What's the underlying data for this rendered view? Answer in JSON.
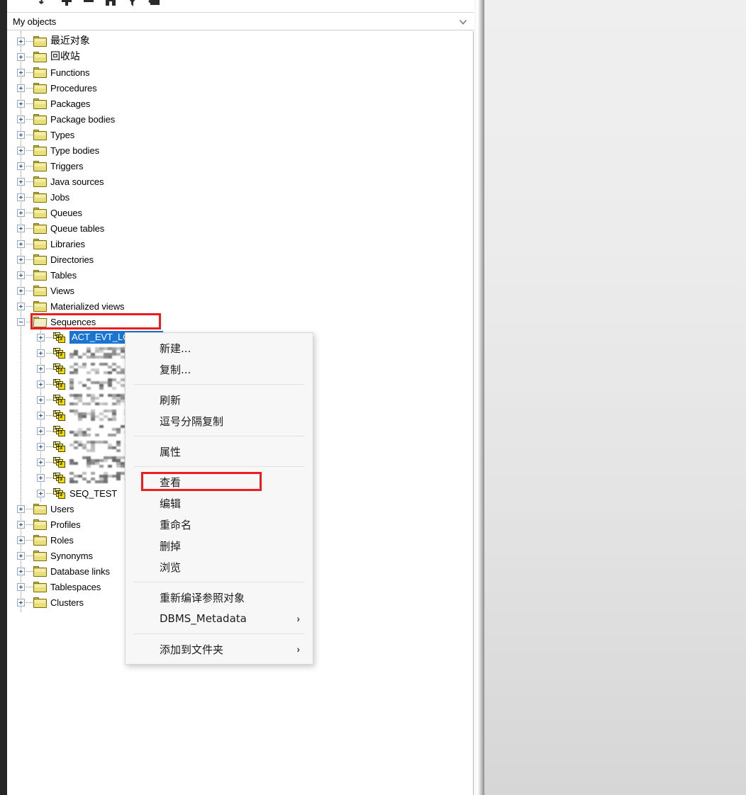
{
  "toolbar": {
    "icons": [
      {
        "name": "back-arrow-icon",
        "label": "Back"
      },
      {
        "name": "add-icon",
        "label": "Add"
      },
      {
        "name": "remove-icon",
        "label": "Remove"
      },
      {
        "name": "binoculars-icon",
        "label": "Find"
      },
      {
        "name": "filter-icon",
        "label": "Filter"
      },
      {
        "name": "copy-folder-icon",
        "label": "Copy to folder"
      }
    ]
  },
  "objects_header": {
    "label": "My objects",
    "chevron": "chevron-down-icon"
  },
  "tree": {
    "root_items": [
      {
        "label": "最近对象",
        "cjk": true,
        "icon": "folder-icon",
        "expander": "plus"
      },
      {
        "label": "回收站",
        "cjk": true,
        "icon": "folder-icon",
        "expander": "plus"
      },
      {
        "label": "Functions",
        "cjk": false,
        "icon": "folder-icon",
        "expander": "plus"
      },
      {
        "label": "Procedures",
        "cjk": false,
        "icon": "folder-icon",
        "expander": "plus"
      },
      {
        "label": "Packages",
        "cjk": false,
        "icon": "folder-icon",
        "expander": "plus"
      },
      {
        "label": "Package bodies",
        "cjk": false,
        "icon": "folder-icon",
        "expander": "plus"
      },
      {
        "label": "Types",
        "cjk": false,
        "icon": "folder-icon",
        "expander": "plus"
      },
      {
        "label": "Type bodies",
        "cjk": false,
        "icon": "folder-icon",
        "expander": "plus"
      },
      {
        "label": "Triggers",
        "cjk": false,
        "icon": "folder-icon",
        "expander": "plus"
      },
      {
        "label": "Java sources",
        "cjk": false,
        "icon": "folder-icon",
        "expander": "plus"
      },
      {
        "label": "Jobs",
        "cjk": false,
        "icon": "folder-icon",
        "expander": "plus"
      },
      {
        "label": "Queues",
        "cjk": false,
        "icon": "folder-icon",
        "expander": "plus"
      },
      {
        "label": "Queue tables",
        "cjk": false,
        "icon": "folder-icon",
        "expander": "plus"
      },
      {
        "label": "Libraries",
        "cjk": false,
        "icon": "folder-icon",
        "expander": "plus"
      },
      {
        "label": "Directories",
        "cjk": false,
        "icon": "folder-icon",
        "expander": "plus"
      },
      {
        "label": "Tables",
        "cjk": false,
        "icon": "folder-icon",
        "expander": "plus"
      },
      {
        "label": "Views",
        "cjk": false,
        "icon": "folder-icon",
        "expander": "plus"
      },
      {
        "label": "Materialized views",
        "cjk": false,
        "icon": "folder-icon",
        "expander": "plus"
      },
      {
        "label": "Sequences",
        "cjk": false,
        "icon": "folder-open-icon",
        "expander": "minus"
      }
    ],
    "sequences": [
      {
        "label": "ACT_EVT_LOG_SEQ",
        "selected": true,
        "redacted": false
      },
      {
        "label": "SEQ__NO",
        "selected": false,
        "redacted": true
      },
      {
        "label": "",
        "selected": false,
        "redacted": true
      },
      {
        "label": "",
        "selected": false,
        "redacted": true
      },
      {
        "label": "",
        "selected": false,
        "redacted": true
      },
      {
        "label": "S_C_N",
        "selected": false,
        "redacted": true
      },
      {
        "label": "S_M_N",
        "selected": false,
        "redacted": true
      },
      {
        "label": "S_C_",
        "selected": false,
        "redacted": true
      },
      {
        "label": "",
        "selected": false,
        "redacted": true
      },
      {
        "label": "Q_N_D",
        "selected": false,
        "redacted": true
      },
      {
        "label": "SEQ_TEST",
        "selected": false,
        "redacted": false
      }
    ],
    "tail_items": [
      {
        "label": "Users",
        "cjk": false,
        "icon": "folder-icon",
        "expander": "plus"
      },
      {
        "label": "Profiles",
        "cjk": false,
        "icon": "folder-icon",
        "expander": "plus"
      },
      {
        "label": "Roles",
        "cjk": false,
        "icon": "folder-icon",
        "expander": "plus"
      },
      {
        "label": "Synonyms",
        "cjk": false,
        "icon": "folder-icon",
        "expander": "plus"
      },
      {
        "label": "Database links",
        "cjk": false,
        "icon": "folder-icon",
        "expander": "plus"
      },
      {
        "label": "Tablespaces",
        "cjk": false,
        "icon": "folder-icon",
        "expander": "plus"
      },
      {
        "label": "Clusters",
        "cjk": false,
        "icon": "folder-icon",
        "expander": "plus"
      }
    ]
  },
  "context_menu": {
    "items": [
      {
        "label": "新建...",
        "type": "item",
        "submenu": "",
        "highlighted": false
      },
      {
        "label": "复制...",
        "type": "item",
        "submenu": "",
        "highlighted": false
      },
      {
        "label": "",
        "type": "separator",
        "submenu": "",
        "highlighted": false
      },
      {
        "label": "刷新",
        "type": "item",
        "submenu": "",
        "highlighted": false
      },
      {
        "label": "逗号分隔复制",
        "type": "item",
        "submenu": "",
        "highlighted": false
      },
      {
        "label": "",
        "type": "separator",
        "submenu": "",
        "highlighted": false
      },
      {
        "label": "属性",
        "type": "item",
        "submenu": "",
        "highlighted": false
      },
      {
        "label": "",
        "type": "separator",
        "submenu": "",
        "highlighted": false
      },
      {
        "label": "查看",
        "type": "item",
        "submenu": "",
        "highlighted": true
      },
      {
        "label": "编辑",
        "type": "item",
        "submenu": "",
        "highlighted": false
      },
      {
        "label": "重命名",
        "type": "item",
        "submenu": "",
        "highlighted": false
      },
      {
        "label": "删掉",
        "type": "item",
        "submenu": "",
        "highlighted": false
      },
      {
        "label": "浏览",
        "type": "item",
        "submenu": "",
        "highlighted": false
      },
      {
        "label": "",
        "type": "separator",
        "submenu": "",
        "highlighted": false
      },
      {
        "label": "重新编译参照对象",
        "type": "item",
        "submenu": "",
        "highlighted": false
      },
      {
        "label": "DBMS_Metadata",
        "type": "item",
        "submenu": "›",
        "highlighted": false
      },
      {
        "label": "",
        "type": "separator",
        "submenu": "",
        "highlighted": false
      },
      {
        "label": "添加到文件夹",
        "type": "item",
        "submenu": "›",
        "highlighted": false
      }
    ]
  },
  "annotations": {
    "sequences_box": "red-highlight-sequences",
    "view_menu_box": "red-highlight-view-item",
    "accent_red": "#ee1c1c",
    "selection_blue": "#1974d2"
  },
  "right_panel": {
    "name": "empty-editor-pane"
  }
}
